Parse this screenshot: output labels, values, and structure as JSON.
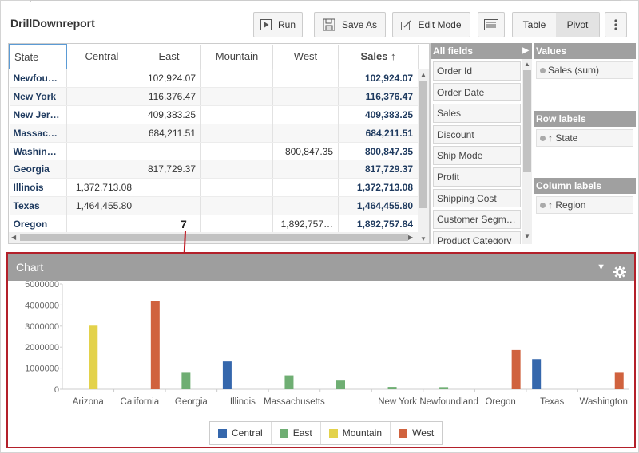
{
  "report": {
    "title": "DrillDownreport"
  },
  "toolbar": {
    "run_label": "Run",
    "save_as_label": "Save As",
    "edit_mode_label": "Edit Mode",
    "view_table_label": "Table",
    "view_pivot_label": "Pivot",
    "active_view": "Pivot"
  },
  "grid": {
    "headers": [
      "State",
      "Central",
      "East",
      "Mountain",
      "West",
      "Sales ↑"
    ],
    "rows": [
      [
        "Newfou…",
        "",
        "102,924.07",
        "",
        "",
        "102,924.07"
      ],
      [
        "New York",
        "",
        "116,376.47",
        "",
        "",
        "116,376.47"
      ],
      [
        "New Jer…",
        "",
        "409,383.25",
        "",
        "",
        "409,383.25"
      ],
      [
        "Massac…",
        "",
        "684,211.51",
        "",
        "",
        "684,211.51"
      ],
      [
        "Washin…",
        "",
        "",
        "",
        "800,847.35",
        "800,847.35"
      ],
      [
        "Georgia",
        "",
        "817,729.37",
        "",
        "",
        "817,729.37"
      ],
      [
        "Illinois",
        "1,372,713.08",
        "",
        "",
        "",
        "1,372,713.08"
      ],
      [
        "Texas",
        "1,464,455.80",
        "",
        "",
        "",
        "1,464,455.80"
      ],
      [
        "Oregon",
        "",
        "",
        "",
        "1,892,757…",
        "1,892,757.84"
      ]
    ]
  },
  "fields": {
    "title": "All fields",
    "items": [
      "Order Id",
      "Order Date",
      "Sales",
      "Discount",
      "Ship Mode",
      "Profit",
      "Shipping Cost",
      "Customer Segm…",
      "Product Category"
    ]
  },
  "values_panel": {
    "title": "Values",
    "items": [
      "Sales (sum)"
    ]
  },
  "row_labels_panel": {
    "title": "Row labels",
    "items": [
      "↑ State"
    ]
  },
  "column_labels_panel": {
    "title": "Column labels",
    "items": [
      "↑ Region"
    ]
  },
  "annotation": {
    "number": "7"
  },
  "chart": {
    "title": "Chart"
  },
  "chart_data": {
    "type": "bar",
    "categories": [
      "Arizona",
      "California",
      "Georgia",
      "Illinois",
      "Massachusetts",
      "",
      "New York",
      "Newfoundland",
      "Oregon",
      "Texas",
      "Washington"
    ],
    "series": [
      {
        "name": "Central",
        "color": "#3567ac",
        "values": [
          0,
          0,
          0,
          1320000,
          0,
          0,
          0,
          0,
          0,
          1430000,
          0
        ]
      },
      {
        "name": "East",
        "color": "#6fae73",
        "values": [
          0,
          0,
          780000,
          0,
          660000,
          410000,
          110000,
          100000,
          0,
          0,
          0
        ]
      },
      {
        "name": "Mountain",
        "color": "#e3d24b",
        "values": [
          3020000,
          0,
          0,
          0,
          0,
          0,
          0,
          0,
          0,
          0,
          0
        ]
      },
      {
        "name": "West",
        "color": "#d0623e",
        "values": [
          0,
          4180000,
          0,
          0,
          0,
          0,
          0,
          0,
          1860000,
          0,
          780000
        ]
      }
    ],
    "ylim": [
      0,
      5000000
    ],
    "yticks": [
      "5000000",
      "4000000",
      "3000000",
      "2000000",
      "1000000",
      "0"
    ],
    "grid": false,
    "legend_position": "bottom"
  }
}
